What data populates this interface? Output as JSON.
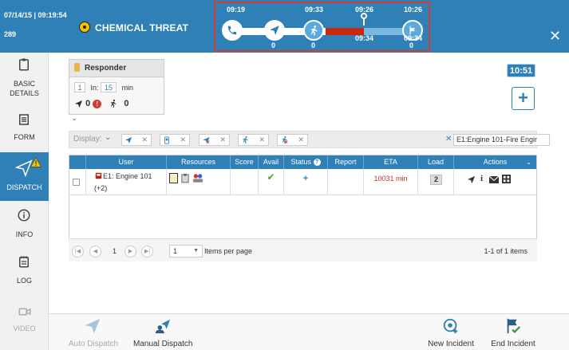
{
  "header": {
    "datetime": "07/14/15 | 09:19:54",
    "incident_id": "289",
    "title": "CHEMICAL THREAT",
    "close_label": "✕"
  },
  "timeline": {
    "times": {
      "call": "09:19",
      "dispatch": "09:33",
      "enroute_pin": "09:26",
      "arrive": "10:26",
      "pin_lower": "09:34",
      "arrive_lower": "09:34"
    },
    "counts": {
      "dispatch": "0",
      "enroute": "0",
      "arrive": "0"
    }
  },
  "sidebar": {
    "items": [
      {
        "label_line1": "BASIC",
        "label_line2": "DETAILS"
      },
      {
        "label_line1": "FORM",
        "label_line2": ""
      },
      {
        "label_line1": "DISPATCH",
        "label_line2": ""
      },
      {
        "label_line1": "INFO",
        "label_line2": ""
      },
      {
        "label_line1": "LOG",
        "label_line2": ""
      },
      {
        "label_line1": "VIDEO",
        "label_line2": ""
      }
    ]
  },
  "responder": {
    "title": "Responder",
    "count": "1",
    "in_label": "In:",
    "minutes": "15",
    "min_label": "min",
    "dispatched": "0",
    "arrived": "0"
  },
  "clock": "10:51",
  "filter": {
    "display_label": "Display:",
    "search_value": "E1:Engine 101-Fire Engir"
  },
  "table": {
    "headers": [
      "User",
      "Resources",
      "Score",
      "Avail",
      "Status",
      "Report",
      "ETA",
      "Load",
      "Actions"
    ],
    "rows": [
      {
        "user": "E1: Engine 101",
        "user_extra": "(+2)",
        "avail": "✔",
        "status": "+",
        "eta": "10031 min",
        "load": "2"
      }
    ]
  },
  "pager": {
    "page": "1",
    "page_size": "1",
    "per_page_label": "Items per page",
    "summary": "1-1 of 1 items"
  },
  "bottombar": {
    "auto_dispatch": "Auto Dispatch",
    "manual_dispatch": "Manual Dispatch",
    "new_incident": "New Incident",
    "end_incident": "End Incident"
  },
  "colors": {
    "brand_blue": "#2f80b6",
    "alert_red": "#d23b30",
    "eta_red": "#c0392b",
    "avail_green": "#5a9e2f"
  }
}
